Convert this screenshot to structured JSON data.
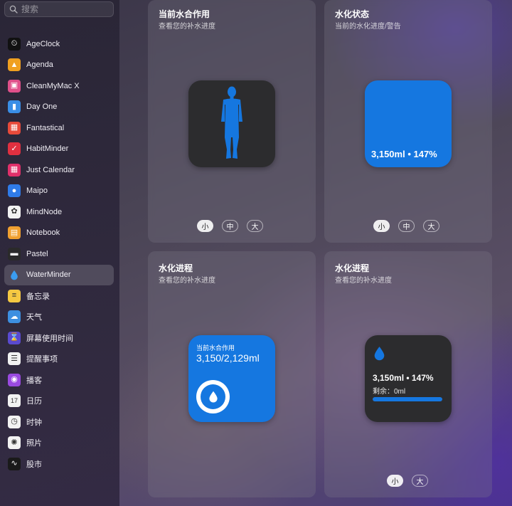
{
  "search": {
    "placeholder": "搜索"
  },
  "sidebar": {
    "items": [
      {
        "label": "AgeClock",
        "icon": "ageclock-icon",
        "glyph": "⏲",
        "bg": "#111111"
      },
      {
        "label": "Agenda",
        "icon": "agenda-icon",
        "glyph": "▲",
        "bg": "#f0a020"
      },
      {
        "label": "CleanMyMac X",
        "icon": "cleanmymac-icon",
        "glyph": "▣",
        "bg": "#e0508a"
      },
      {
        "label": "Day One",
        "icon": "dayone-icon",
        "glyph": "▮",
        "bg": "#3a8ee6"
      },
      {
        "label": "Fantastical",
        "icon": "fantastical-icon",
        "glyph": "▦",
        "bg": "#e84a3a"
      },
      {
        "label": "HabitMinder",
        "icon": "habitminder-icon",
        "glyph": "✓",
        "bg": "#e03040"
      },
      {
        "label": "Just Calendar",
        "icon": "justcalendar-icon",
        "glyph": "▦",
        "bg": "#e0306a"
      },
      {
        "label": "Maipo",
        "icon": "maipo-icon",
        "glyph": "●",
        "bg": "#2f7be8"
      },
      {
        "label": "MindNode",
        "icon": "mindnode-icon",
        "glyph": "✿",
        "bg": "#f2f2f2"
      },
      {
        "label": "Notebook",
        "icon": "notebook-icon",
        "glyph": "▤",
        "bg": "#f0a030"
      },
      {
        "label": "Pastel",
        "icon": "pastel-icon",
        "glyph": "▬",
        "bg": "#2a2a2a"
      },
      {
        "label": "WaterMinder",
        "icon": "waterminder-icon",
        "glyph": "💧",
        "bg": "transparent",
        "selected": true
      },
      {
        "label": "备忘录",
        "icon": "notes-icon",
        "glyph": "≡",
        "bg": "#f5c842"
      },
      {
        "label": "天气",
        "icon": "weather-icon",
        "glyph": "☁",
        "bg": "#3d8fe0"
      },
      {
        "label": "屏幕使用时间",
        "icon": "screentime-icon",
        "glyph": "⌛",
        "bg": "#5a4ad0"
      },
      {
        "label": "提醒事项",
        "icon": "reminders-icon",
        "glyph": "☰",
        "bg": "#f2f2f2"
      },
      {
        "label": "播客",
        "icon": "podcasts-icon",
        "glyph": "◉",
        "bg": "#9a4ae0"
      },
      {
        "label": "日历",
        "icon": "calendar-icon",
        "glyph": "17",
        "bg": "#f2f2f2"
      },
      {
        "label": "时钟",
        "icon": "clock-icon",
        "glyph": "◷",
        "bg": "#f2f2f2"
      },
      {
        "label": "照片",
        "icon": "photos-icon",
        "glyph": "✺",
        "bg": "#f2f2f2"
      },
      {
        "label": "股市",
        "icon": "stocks-icon",
        "glyph": "∿",
        "bg": "#1a1a1a"
      }
    ]
  },
  "cards": {
    "c1": {
      "title": "当前水合作用",
      "subtitle": "查看您的补水进度",
      "sizes": [
        "小",
        "中",
        "大"
      ]
    },
    "c2": {
      "title": "水化状态",
      "subtitle": "当前的水化进度/警告",
      "value": "3,150ml • 147%",
      "sizes": [
        "小",
        "中",
        "大"
      ]
    },
    "c3": {
      "title": "水化进程",
      "subtitle": "查看您的补水进度",
      "widget_label": "当前水合作用",
      "widget_value": "3,150/2,129ml"
    },
    "c4": {
      "title": "水化进程",
      "subtitle": "查看您的补水进度",
      "value": "3,150ml • 147%",
      "remaining": "剩余：0ml",
      "progress": 1.0,
      "sizes": [
        "小",
        "大"
      ]
    }
  },
  "colors": {
    "accent": "#1577e0",
    "widget_dark": "#2c2c2e"
  }
}
